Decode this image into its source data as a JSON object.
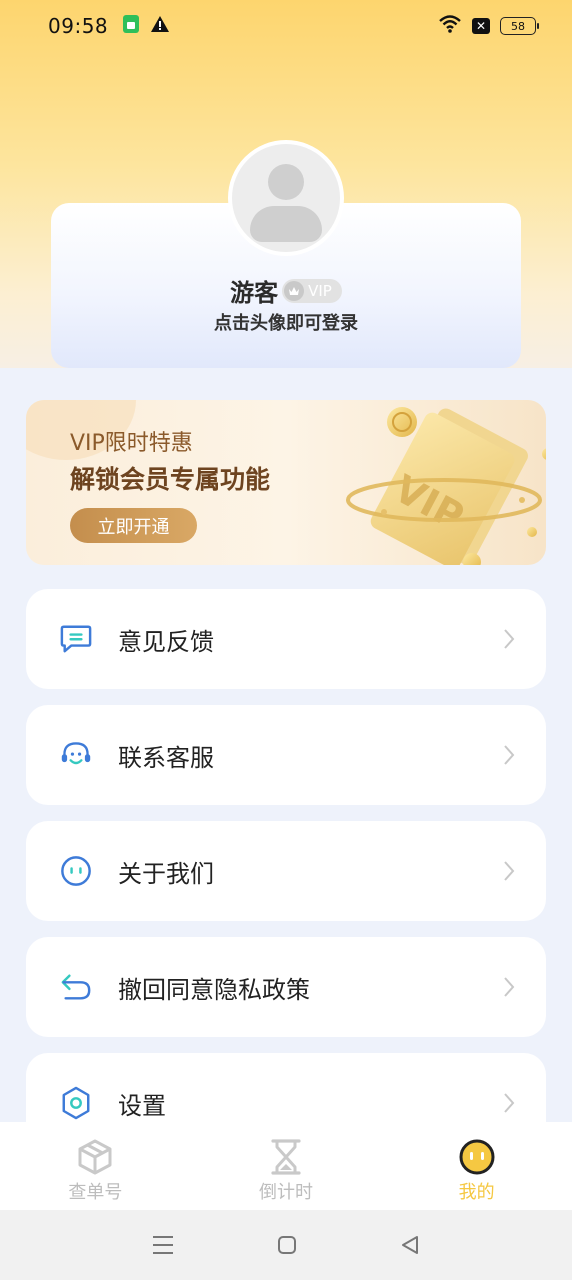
{
  "status_bar": {
    "time": "09:58",
    "battery": "58",
    "icons": [
      "sim-icon",
      "warning-icon",
      "wifi-icon",
      "no-signal-icon",
      "battery-icon"
    ]
  },
  "profile": {
    "name": "游客",
    "vip_label": "VIP",
    "login_hint": "点击头像即可登录"
  },
  "vip_banner": {
    "title": "VIP限时特惠",
    "subtitle": "解锁会员专属功能",
    "button_label": "立即开通",
    "card_text": "VIP"
  },
  "menu": {
    "items": [
      {
        "label": "意见反馈",
        "icon": "feedback-icon"
      },
      {
        "label": "联系客服",
        "icon": "headset-icon"
      },
      {
        "label": "关于我们",
        "icon": "smiley-icon"
      },
      {
        "label": "撤回同意隐私政策",
        "icon": "undo-icon"
      },
      {
        "label": "设置",
        "icon": "settings-icon"
      }
    ]
  },
  "bottom_nav": {
    "items": [
      {
        "label": "查单号",
        "icon": "package-icon",
        "active": false
      },
      {
        "label": "倒计时",
        "icon": "hourglass-icon",
        "active": false
      },
      {
        "label": "我的",
        "icon": "face-icon",
        "active": true
      }
    ]
  },
  "colors": {
    "accent_yellow": "#f5c842",
    "menu_icon_blue": "#3e7bd8",
    "menu_icon_teal": "#35c9c0",
    "vip_gold": "#c48e4d"
  }
}
